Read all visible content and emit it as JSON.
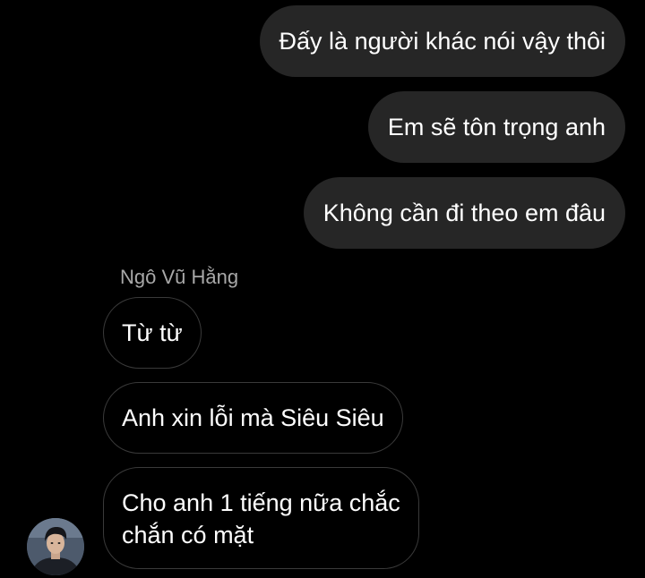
{
  "conversation": {
    "outgoing": [
      {
        "text": "Đấy là người khác nói vậy thôi"
      },
      {
        "text": "Em sẽ tôn trọng anh"
      },
      {
        "text": "Không cần đi theo em đâu"
      }
    ],
    "sender_name": "Ngô Vũ Hằng",
    "incoming": [
      {
        "text": "Từ từ"
      },
      {
        "text": "Anh xin lỗi mà Siêu Siêu"
      },
      {
        "line1": "Cho anh 1 tiếng nữa chắc",
        "line2": "chắn có mặt"
      }
    ]
  },
  "colors": {
    "background": "#000000",
    "outgoing_bubble": "#262626",
    "incoming_border": "#3a3a3a",
    "sender_name": "#a8a8a8"
  },
  "icons": {
    "avatar": "profile-photo"
  }
}
